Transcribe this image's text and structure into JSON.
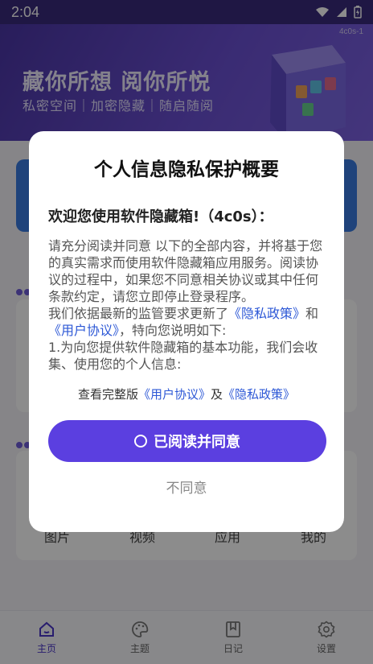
{
  "status_bar": {
    "time": "2:04"
  },
  "hero": {
    "version": "4c0s-1",
    "title": "藏你所想 阅你所悦",
    "subtitle": "私密空间｜加密隐藏｜随启随阅"
  },
  "grid_labels": [
    "图片",
    "视频",
    "应用",
    "我的"
  ],
  "tabs": [
    {
      "label": "主页",
      "icon": "home-icon",
      "active": true
    },
    {
      "label": "主题",
      "icon": "palette-icon",
      "active": false
    },
    {
      "label": "日记",
      "icon": "bookmark-icon",
      "active": false
    },
    {
      "label": "设置",
      "icon": "gear-icon",
      "active": false
    }
  ],
  "dialog": {
    "title": "个人信息隐私保护概要",
    "welcome": "欢迎您使用软件隐藏箱!（4c0s）：",
    "para1": "请充分阅读并同意 以下的全部内容，并将基于您的真实需求而使用软件隐藏箱应用服务。阅读协议的过程中，如果您不同意相关协议或其中任何条款约定，请您立即停止登录程序。",
    "para2_prefix": "我们依据最新的监管要求更新了",
    "privacy_link": "《隐私政策》",
    "and_text": "和",
    "user_link": "《用户协议》",
    "para2_suffix": "，特向您说明如下:",
    "para3": "1.为向您提供软件隐藏箱的基本功能，我们会收集、使用您的个人信息:",
    "full_prefix": "查看完整版",
    "full_user_link": "《用户协议》",
    "full_and": "及",
    "full_privacy_link": "《隐私政策》",
    "agree_label": "已阅读并同意",
    "decline_label": "不同意"
  },
  "colors": {
    "accent": "#5b3fe0",
    "link": "#2d58d6",
    "hero": "#5a42c0"
  }
}
